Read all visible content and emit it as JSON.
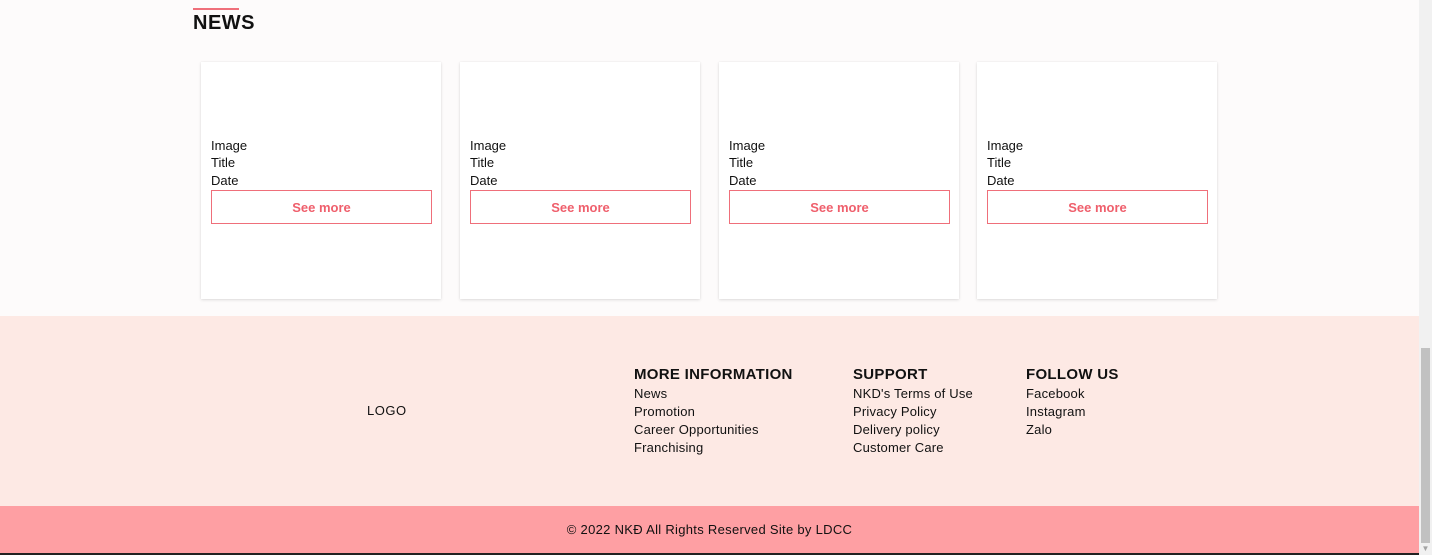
{
  "news": {
    "title": "NEWS",
    "cards": [
      {
        "image": "Image",
        "title": "Title",
        "date": "Date",
        "button": "See more"
      },
      {
        "image": "Image",
        "title": "Title",
        "date": "Date",
        "button": "See more"
      },
      {
        "image": "Image",
        "title": "Title",
        "date": "Date",
        "button": "See more"
      },
      {
        "image": "Image",
        "title": "Title",
        "date": "Date",
        "button": "See more"
      }
    ]
  },
  "footer": {
    "logo": "LOGO",
    "more_information": {
      "heading": "MORE INFORMATION",
      "links": [
        "News",
        "Promotion",
        "Career Opportunities",
        "Franchising"
      ]
    },
    "support": {
      "heading": "SUPPORT",
      "links": [
        "NKD's Terms of Use",
        "Privacy Policy",
        "Delivery policy",
        "Customer Care"
      ]
    },
    "follow_us": {
      "heading": "FOLLOW US",
      "links": [
        "Facebook",
        "Instagram",
        "Zalo"
      ]
    },
    "copyright": "© 2022 NKĐ All Rights Reserved Site by LDCC"
  },
  "colors": {
    "accent": "#ef6f7a",
    "footer_bg": "#fde9e4",
    "copyright_bg": "#fe9fa3"
  },
  "icons": {
    "scroll_down": "chevron-down-icon"
  }
}
